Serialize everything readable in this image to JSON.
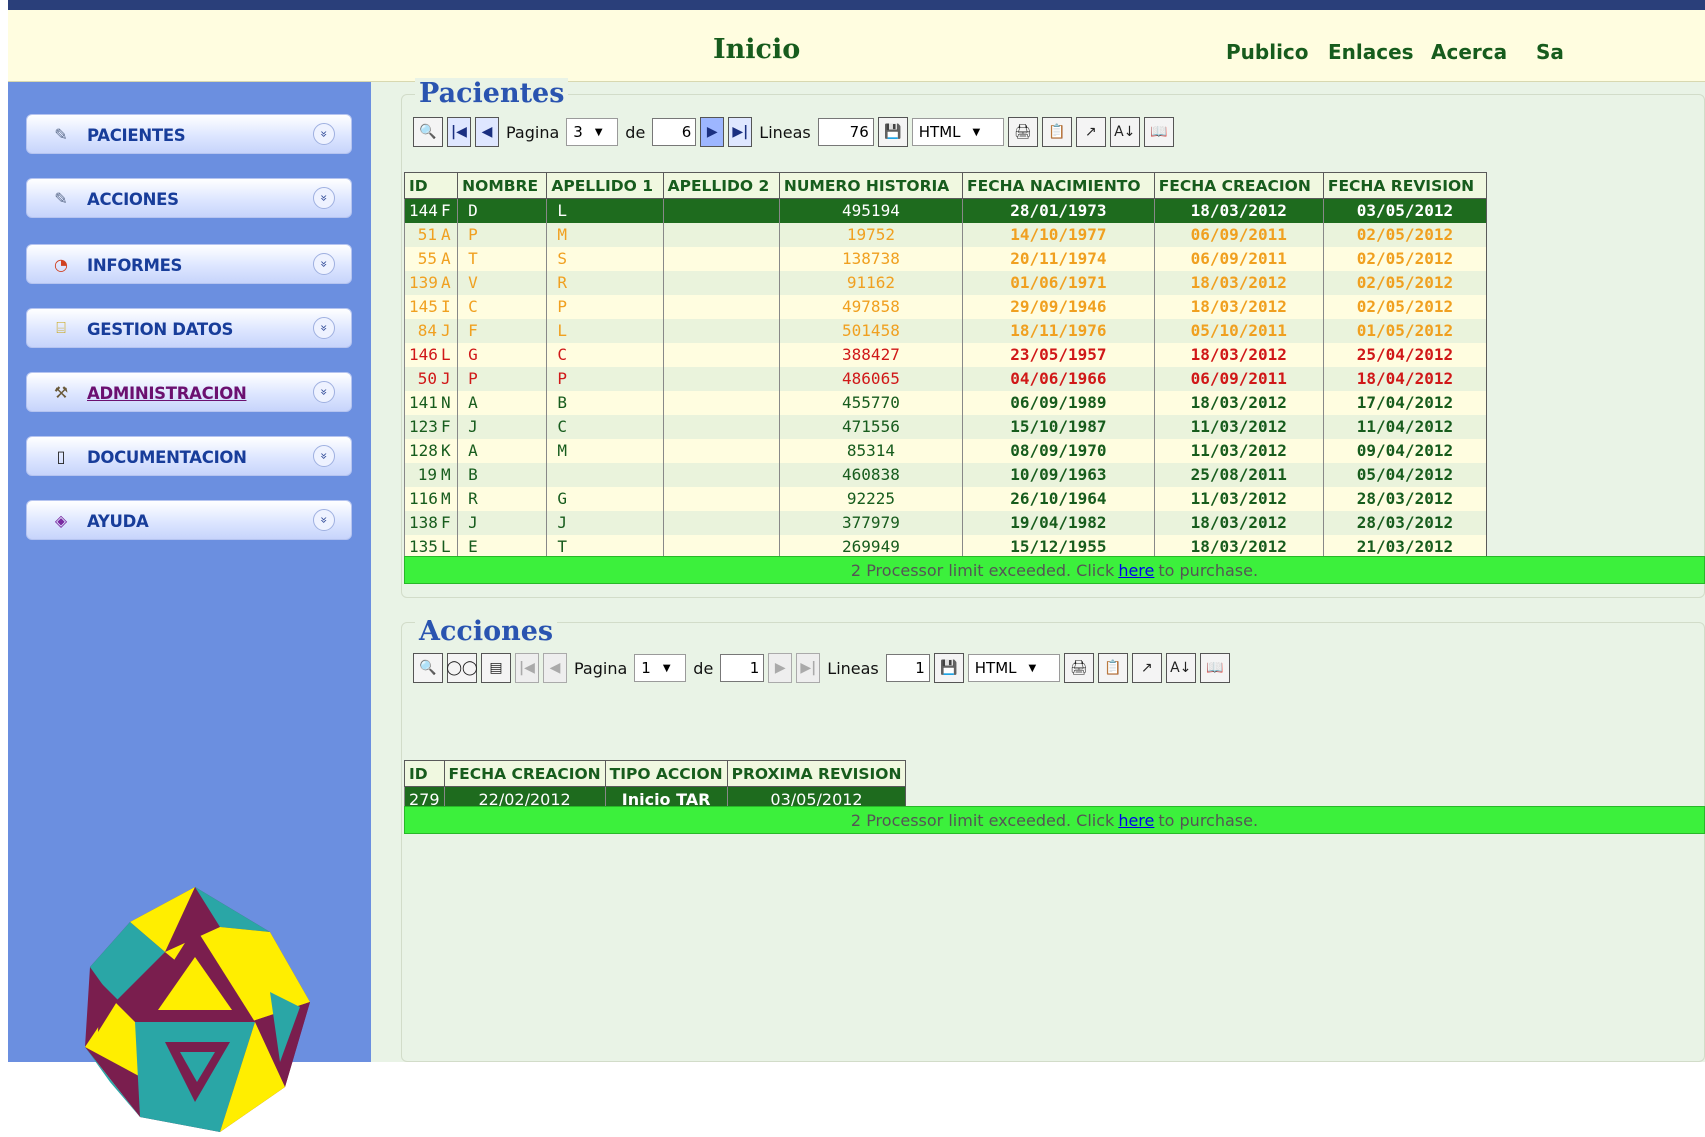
{
  "header": {
    "title": "Inicio",
    "links": [
      "Publico",
      "Enlaces",
      "Acerca",
      "Sa"
    ]
  },
  "sidebar": {
    "items": [
      {
        "label": "PACIENTES",
        "icon": "edit-icon"
      },
      {
        "label": "ACCIONES",
        "icon": "edit-icon"
      },
      {
        "label": "INFORMES",
        "icon": "pie-chart-icon"
      },
      {
        "label": "GESTION DATOS",
        "icon": "database-icon"
      },
      {
        "label": "ADMINISTRACION",
        "icon": "tools-icon",
        "active": true
      },
      {
        "label": "DOCUMENTACION",
        "icon": "book-icon"
      },
      {
        "label": "AYUDA",
        "icon": "help-book-icon"
      }
    ]
  },
  "pacientes": {
    "title": "Pacientes",
    "pager": {
      "pagina_label": "Pagina",
      "page": "3",
      "de_label": "de",
      "total": "6",
      "lineas_label": "Lineas",
      "lineas": "76",
      "format": "HTML"
    },
    "columns": [
      "ID",
      "NOMBRE",
      "APELLIDO 1",
      "APELLIDO 2",
      "NUMERO HISTORIA",
      "FECHA NACIMIENTO",
      "FECHA CREACION",
      "FECHA REVISION"
    ],
    "rows": [
      {
        "id": "144",
        "sex": "F",
        "nombre": "D",
        "ap1": "L",
        "ap2": "",
        "historia": "495194",
        "nac": "28/01/1973",
        "creacion": "18/03/2012",
        "revision": "03/05/2012",
        "style": "selected"
      },
      {
        "id": "51",
        "sex": "A",
        "nombre": "P",
        "ap1": "M",
        "ap2": "",
        "historia": "19752",
        "nac": "14/10/1977",
        "creacion": "06/09/2011",
        "revision": "02/05/2012",
        "style": "orange"
      },
      {
        "id": "55",
        "sex": "A",
        "nombre": "T",
        "ap1": "S",
        "ap2": "",
        "historia": "138738",
        "nac": "20/11/1974",
        "creacion": "06/09/2011",
        "revision": "02/05/2012",
        "style": "orange"
      },
      {
        "id": "139",
        "sex": "A",
        "nombre": "V",
        "ap1": "R",
        "ap2": "",
        "historia": "91162",
        "nac": "01/06/1971",
        "creacion": "18/03/2012",
        "revision": "02/05/2012",
        "style": "orange"
      },
      {
        "id": "145",
        "sex": "I",
        "nombre": "C",
        "ap1": "P",
        "ap2": "",
        "historia": "497858",
        "nac": "29/09/1946",
        "creacion": "18/03/2012",
        "revision": "02/05/2012",
        "style": "orange"
      },
      {
        "id": "84",
        "sex": "J",
        "nombre": "F",
        "ap1": "L",
        "ap2": "",
        "historia": "501458",
        "nac": "18/11/1976",
        "creacion": "05/10/2011",
        "revision": "01/05/2012",
        "style": "orange"
      },
      {
        "id": "146",
        "sex": "L",
        "nombre": "G",
        "ap1": "C",
        "ap2": "",
        "historia": "388427",
        "nac": "23/05/1957",
        "creacion": "18/03/2012",
        "revision": "25/04/2012",
        "style": "red"
      },
      {
        "id": "50",
        "sex": "J",
        "nombre": "P",
        "ap1": "P",
        "ap2": "",
        "historia": "486065",
        "nac": "04/06/1966",
        "creacion": "06/09/2011",
        "revision": "18/04/2012",
        "style": "red"
      },
      {
        "id": "141",
        "sex": "N",
        "nombre": "A",
        "ap1": "B",
        "ap2": "",
        "historia": "455770",
        "nac": "06/09/1989",
        "creacion": "18/03/2012",
        "revision": "17/04/2012",
        "style": "green"
      },
      {
        "id": "123",
        "sex": "F",
        "nombre": "J",
        "ap1": "C",
        "ap2": "",
        "historia": "471556",
        "nac": "15/10/1987",
        "creacion": "11/03/2012",
        "revision": "11/04/2012",
        "style": "green"
      },
      {
        "id": "128",
        "sex": "K",
        "nombre": "A",
        "ap1": "M",
        "ap2": "",
        "historia": "85314",
        "nac": "08/09/1970",
        "creacion": "11/03/2012",
        "revision": "09/04/2012",
        "style": "green"
      },
      {
        "id": "19",
        "sex": "M",
        "nombre": "B",
        "ap1": "",
        "ap2": "",
        "historia": "460838",
        "nac": "10/09/1963",
        "creacion": "25/08/2011",
        "revision": "05/04/2012",
        "style": "green"
      },
      {
        "id": "116",
        "sex": "M",
        "nombre": "R",
        "ap1": "G",
        "ap2": "",
        "historia": "92225",
        "nac": "26/10/1964",
        "creacion": "11/03/2012",
        "revision": "28/03/2012",
        "style": "green"
      },
      {
        "id": "138",
        "sex": "F",
        "nombre": "J",
        "ap1": "J",
        "ap2": "",
        "historia": "377979",
        "nac": "19/04/1982",
        "creacion": "18/03/2012",
        "revision": "28/03/2012",
        "style": "green"
      },
      {
        "id": "135",
        "sex": "L",
        "nombre": "E",
        "ap1": "T",
        "ap2": "",
        "historia": "269949",
        "nac": "15/12/1955",
        "creacion": "18/03/2012",
        "revision": "21/03/2012",
        "style": "green"
      }
    ],
    "purchase": {
      "before": "2 Processor limit exceeded. Click",
      "link": "here",
      "after": "to purchase."
    }
  },
  "acciones": {
    "title": "Acciones",
    "pager": {
      "pagina_label": "Pagina",
      "page": "1",
      "de_label": "de",
      "total": "1",
      "lineas_label": "Lineas",
      "lineas": "1",
      "format": "HTML"
    },
    "columns": [
      "ID",
      "FECHA CREACION",
      "TIPO ACCION",
      "PROXIMA REVISION"
    ],
    "rows": [
      {
        "id": "279",
        "creacion": "22/02/2012",
        "tipo": "Inicio TAR",
        "revision": "03/05/2012"
      }
    ],
    "purchase": {
      "before": "2 Processor limit exceeded. Click",
      "link": "here",
      "after": "to purchase."
    }
  },
  "colors": {
    "header_bg": "#fffde0",
    "sidebar_bg": "#6b8fe0",
    "content_bg": "#e9f3e6",
    "selected_row": "#1e6b1e",
    "row_orange": "#f0a020",
    "row_red": "#d01818",
    "row_green": "#175c1d",
    "row_bg_light": "#fffde0",
    "row_bg_alt": "#eaf3dc",
    "banner": "#3cf03c"
  }
}
